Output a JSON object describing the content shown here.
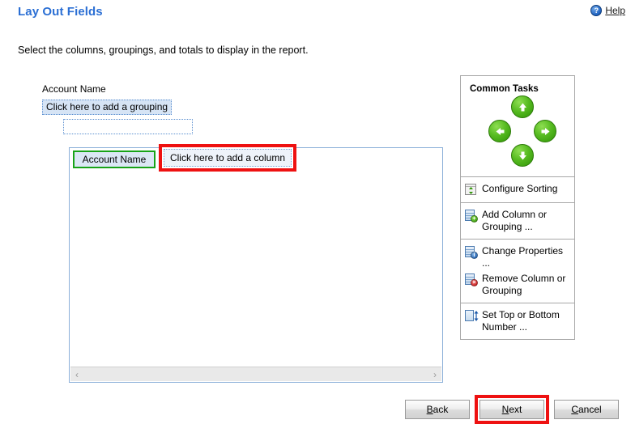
{
  "header": {
    "title": "Lay Out Fields",
    "help_label": "Help",
    "help_icon": "question-mark-circle-icon",
    "help_glyph": "?"
  },
  "instruction": "Select the columns, groupings, and totals to display in the report.",
  "grouping": {
    "label": "Account Name",
    "add_grouping_label": "Click here to add a grouping",
    "empty_slot_label": ""
  },
  "report_design": {
    "columns": [
      {
        "label": "Account Name",
        "state": "selected"
      },
      {
        "label": "Click here to add a column",
        "state": "add-placeholder"
      }
    ],
    "scroll_left_glyph": "‹",
    "scroll_right_glyph": "›"
  },
  "common_tasks": {
    "title": "Common Tasks",
    "nav_arrows": [
      {
        "name": "move-up",
        "direction": "up"
      },
      {
        "name": "move-left",
        "direction": "left"
      },
      {
        "name": "move-right",
        "direction": "right"
      },
      {
        "name": "move-down",
        "direction": "down"
      }
    ],
    "items": [
      {
        "label": "Configure Sorting",
        "icon": "sort-icon"
      },
      {
        "label": "Add Column or Grouping ...",
        "icon": "add-column-icon"
      },
      {
        "label": "Change Properties ...",
        "icon": "properties-icon"
      },
      {
        "label": "Remove Column or Grouping",
        "icon": "remove-column-icon"
      },
      {
        "label": "Set Top or Bottom Number ...",
        "icon": "top-bottom-number-icon"
      }
    ]
  },
  "footer": {
    "back": {
      "accel": "B",
      "rest": "ack"
    },
    "next": {
      "accel": "N",
      "rest": "ext"
    },
    "cancel": {
      "accel": "C",
      "rest": "ancel"
    }
  },
  "colors": {
    "title_blue": "#2b6fd4",
    "highlight_red": "#ee1111",
    "selected_green": "#18a318",
    "panel_border_blue": "#8cb0d9",
    "grouping_fill": "#d6e4f5"
  }
}
